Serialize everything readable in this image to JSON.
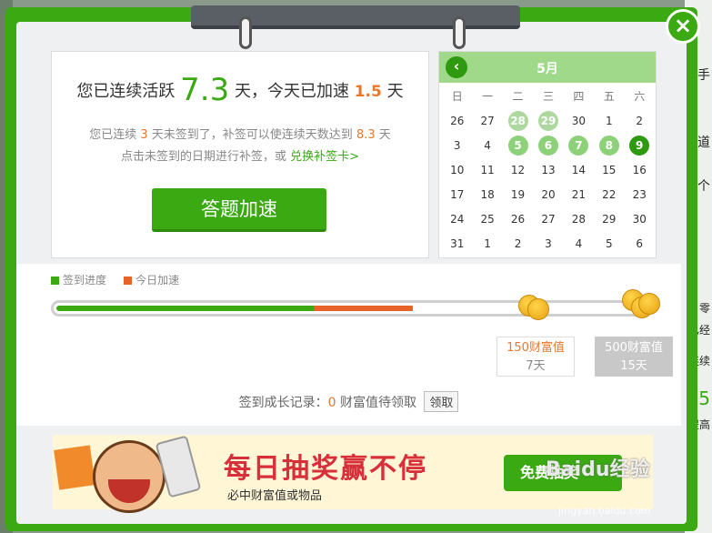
{
  "background_right": [
    "手",
    "道",
    "一个",
    "零",
    "已经",
    "连续",
    "5",
    "提高"
  ],
  "header": {
    "close_label": "×"
  },
  "status": {
    "prefix": "您已连续活跃",
    "active_days": "7.3",
    "mid": "天，今天已加速",
    "boost_days": "1.5",
    "suffix": "天",
    "unsigned_prefix": "您已连续",
    "unsigned_days": "3",
    "unsigned_mid": "天未签到了，补签可以使连续天数达到",
    "target_days": "8.3",
    "unsigned_suffix": "天",
    "line3_text": "点击未签到的日期进行补签，或",
    "exchange_link": "兑换补签卡>"
  },
  "speedup_button": "答题加速",
  "calendar": {
    "month": "5月",
    "weekdays": [
      "日",
      "一",
      "二",
      "三",
      "四",
      "五",
      "六"
    ],
    "weeks": [
      [
        "26",
        "27",
        "28",
        "29",
        "30",
        "1",
        "2"
      ],
      [
        "3",
        "4",
        "5",
        "6",
        "7",
        "8",
        "9"
      ],
      [
        "10",
        "11",
        "12",
        "13",
        "14",
        "15",
        "16"
      ],
      [
        "17",
        "18",
        "19",
        "20",
        "21",
        "22",
        "23"
      ],
      [
        "24",
        "25",
        "26",
        "27",
        "28",
        "29",
        "30"
      ],
      [
        "31",
        "1",
        "2",
        "3",
        "4",
        "5",
        "6"
      ]
    ],
    "faded_days": [
      "28",
      "29"
    ],
    "signed_days": [
      "5",
      "6",
      "7",
      "8"
    ],
    "today": "9"
  },
  "progress": {
    "legend_signed": "签到进度",
    "legend_today": "今日加速",
    "signed_fraction": 0.44,
    "today_fraction": 0.17,
    "colors": {
      "signed": "#3aa912",
      "today": "#e8632a"
    }
  },
  "rewards": [
    {
      "value": "150财富值",
      "days": "7天"
    },
    {
      "value": "500财富值",
      "days": "15天"
    }
  ],
  "record": {
    "label": "签到成长记录：",
    "count": "0",
    "suffix": "财富值待领取",
    "claim_button": "领取"
  },
  "banner": {
    "title": "每日抽奖赢不停",
    "subtitle": "必中财富值或物品",
    "button": "免费抽奖"
  },
  "watermark": {
    "brand": "Baidu经验",
    "url": "jingyan.baidu.com"
  },
  "colors": {
    "accent": "#3aa912",
    "highlight": "#e8772a",
    "banner_red": "#d8303a"
  }
}
